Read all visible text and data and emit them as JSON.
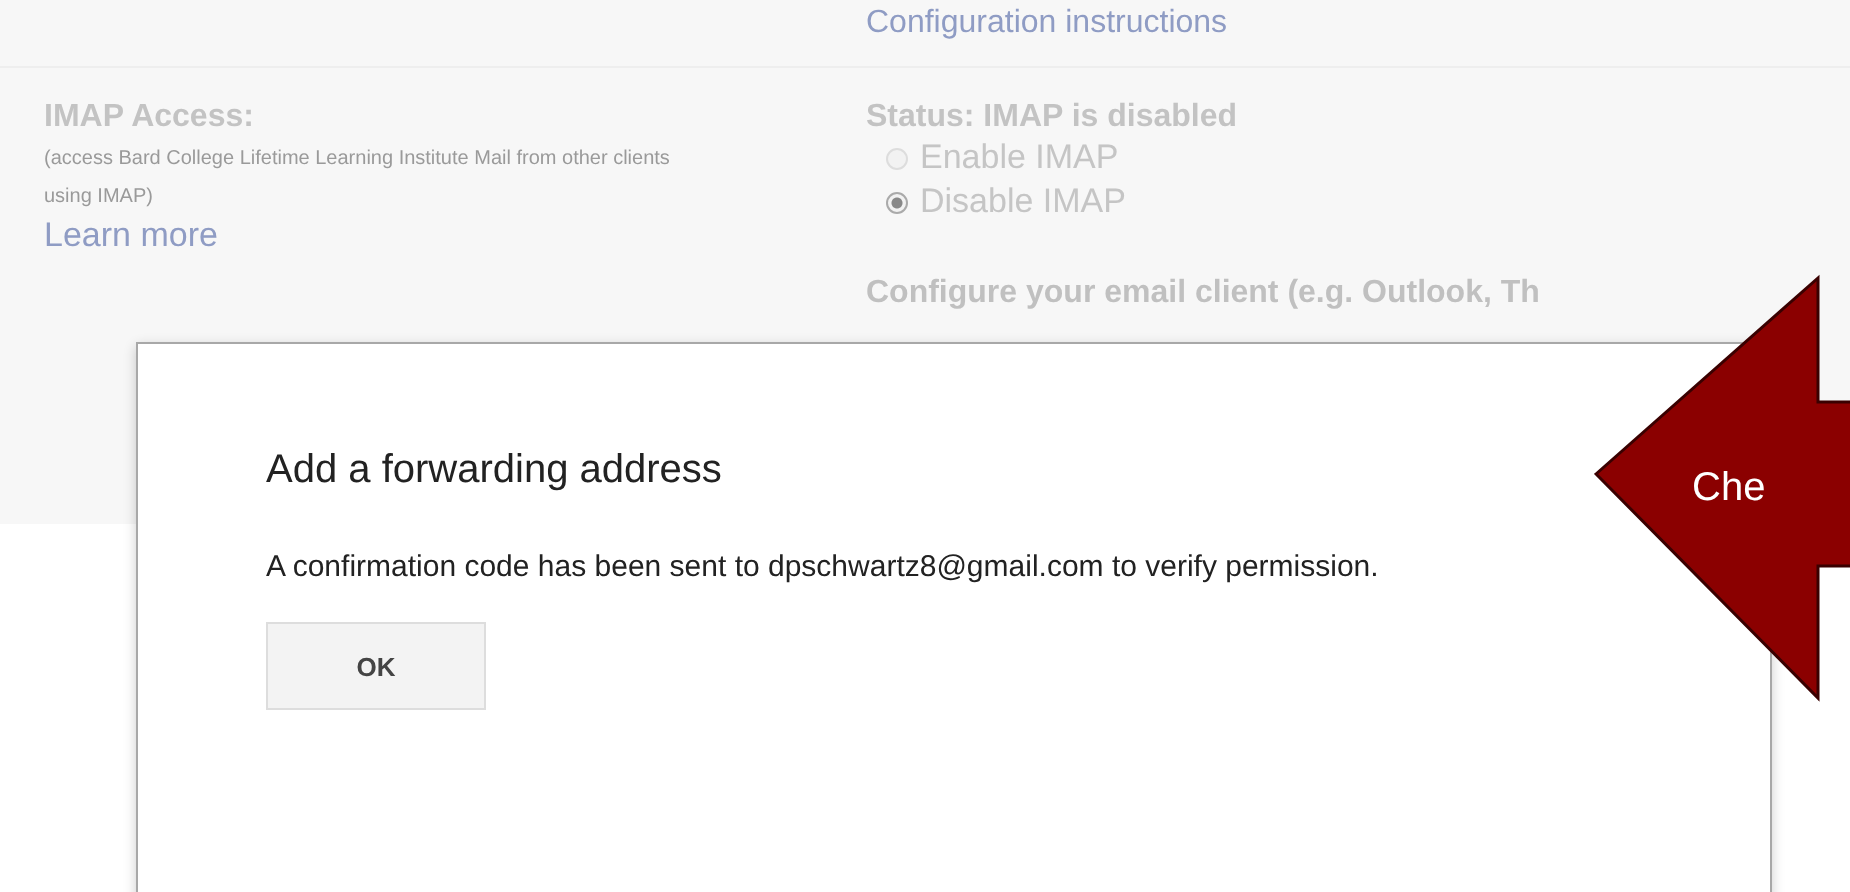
{
  "settings": {
    "config_link": "Configuration instructions",
    "imap": {
      "label": "IMAP Access:",
      "description": "(access Bard College Lifetime Learning Institute Mail from other clients using IMAP)",
      "learn_more": "Learn more",
      "status": "Status: IMAP is disabled",
      "options": [
        {
          "label": "Enable IMAP",
          "selected": false
        },
        {
          "label": "Disable IMAP",
          "selected": true
        }
      ],
      "configure": "Configure your email client (e.g. Outlook, Th"
    }
  },
  "dialog": {
    "title": "Add a forwarding address",
    "message": "A confirmation code has been sent to dpschwartz8@gmail.com to verify permission.",
    "buttons": [
      "OK"
    ]
  },
  "callout": {
    "text": "Che"
  }
}
